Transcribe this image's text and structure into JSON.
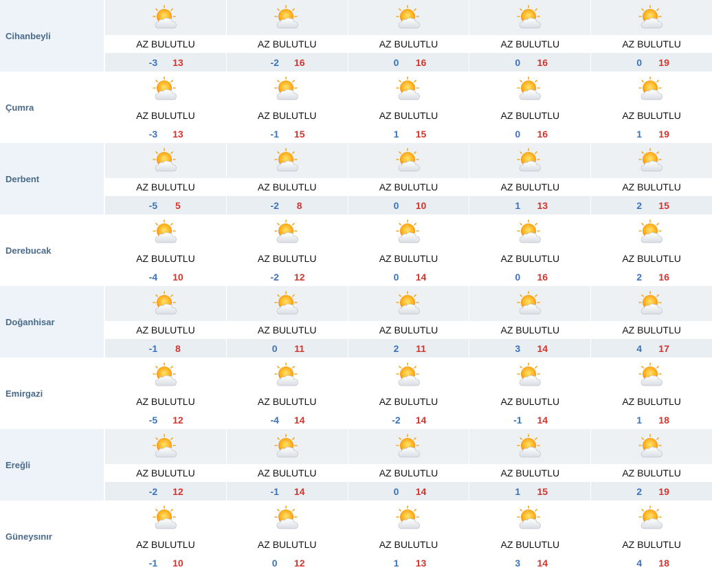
{
  "condition_label": "AZ BULUTLU",
  "icon": "partly-cloudy-sun-icon",
  "colors": {
    "min_temp": "#3b73b9",
    "max_temp": "#d2352e",
    "city_text": "#4a6a8a"
  },
  "rows": [
    {
      "city": "Cihanbeyli",
      "days": [
        {
          "min": "-3",
          "max": "13"
        },
        {
          "min": "-2",
          "max": "16"
        },
        {
          "min": "0",
          "max": "16"
        },
        {
          "min": "0",
          "max": "16"
        },
        {
          "min": "0",
          "max": "19"
        }
      ]
    },
    {
      "city": "Çumra",
      "days": [
        {
          "min": "-3",
          "max": "13"
        },
        {
          "min": "-1",
          "max": "15"
        },
        {
          "min": "1",
          "max": "15"
        },
        {
          "min": "0",
          "max": "16"
        },
        {
          "min": "1",
          "max": "19"
        }
      ]
    },
    {
      "city": "Derbent",
      "days": [
        {
          "min": "-5",
          "max": "5"
        },
        {
          "min": "-2",
          "max": "8"
        },
        {
          "min": "0",
          "max": "10"
        },
        {
          "min": "1",
          "max": "13"
        },
        {
          "min": "2",
          "max": "15"
        }
      ]
    },
    {
      "city": "Derebucak",
      "days": [
        {
          "min": "-4",
          "max": "10"
        },
        {
          "min": "-2",
          "max": "12"
        },
        {
          "min": "0",
          "max": "14"
        },
        {
          "min": "0",
          "max": "16"
        },
        {
          "min": "2",
          "max": "16"
        }
      ]
    },
    {
      "city": "Doğanhisar",
      "days": [
        {
          "min": "-1",
          "max": "8"
        },
        {
          "min": "0",
          "max": "11"
        },
        {
          "min": "2",
          "max": "11"
        },
        {
          "min": "3",
          "max": "14"
        },
        {
          "min": "4",
          "max": "17"
        }
      ]
    },
    {
      "city": "Emirgazi",
      "days": [
        {
          "min": "-5",
          "max": "12"
        },
        {
          "min": "-4",
          "max": "14"
        },
        {
          "min": "-2",
          "max": "14"
        },
        {
          "min": "-1",
          "max": "14"
        },
        {
          "min": "1",
          "max": "18"
        }
      ]
    },
    {
      "city": "Ereğli",
      "days": [
        {
          "min": "-2",
          "max": "12"
        },
        {
          "min": "-1",
          "max": "14"
        },
        {
          "min": "0",
          "max": "14"
        },
        {
          "min": "1",
          "max": "15"
        },
        {
          "min": "2",
          "max": "19"
        }
      ]
    },
    {
      "city": "Güneysınır",
      "days": [
        {
          "min": "-1",
          "max": "10"
        },
        {
          "min": "0",
          "max": "12"
        },
        {
          "min": "1",
          "max": "13"
        },
        {
          "min": "3",
          "max": "14"
        },
        {
          "min": "4",
          "max": "18"
        }
      ]
    }
  ]
}
